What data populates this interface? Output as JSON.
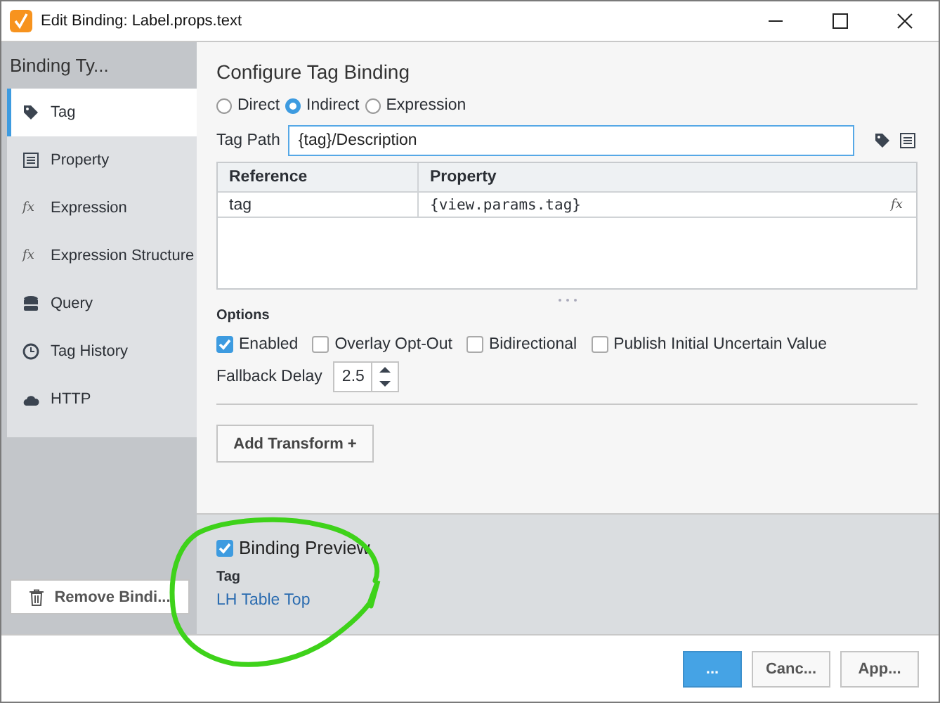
{
  "window": {
    "title": "Edit Binding: Label.props.text"
  },
  "sidebar": {
    "title": "Binding Ty...",
    "items": [
      {
        "label": "Tag",
        "selected": true
      },
      {
        "label": "Property",
        "selected": false
      },
      {
        "label": "Expression",
        "selected": false,
        "glyph": "fx"
      },
      {
        "label": "Expression Structure",
        "selected": false,
        "glyph": "fx"
      },
      {
        "label": "Query",
        "selected": false
      },
      {
        "label": "Tag History",
        "selected": false
      },
      {
        "label": "HTTP",
        "selected": false
      }
    ],
    "remove_button": "Remove Bindi..."
  },
  "config": {
    "title": "Configure Tag Binding",
    "modes": [
      {
        "label": "Direct",
        "selected": false
      },
      {
        "label": "Indirect",
        "selected": true
      },
      {
        "label": "Expression",
        "selected": false
      }
    ],
    "tag_path": {
      "label": "Tag Path",
      "value": "{tag}/Description"
    },
    "table": {
      "columns": [
        "Reference",
        "Property"
      ],
      "rows": [
        {
          "cells": [
            "tag",
            "{view.params.tag}"
          ],
          "action": "fx"
        }
      ]
    },
    "options": {
      "title": "Options",
      "checkboxes": [
        {
          "label": "Enabled",
          "checked": true
        },
        {
          "label": "Overlay Opt-Out",
          "checked": false
        },
        {
          "label": "Bidirectional",
          "checked": false
        },
        {
          "label": "Publish Initial Uncertain Value",
          "checked": false
        }
      ]
    },
    "fallback_delay": {
      "label": "Fallback Delay",
      "value": "2.5"
    },
    "add_transform": "Add Transform +"
  },
  "preview": {
    "label": "Binding Preview",
    "checked": true,
    "type_label": "Tag",
    "value": "LH Table Top"
  },
  "buttons": [
    {
      "label": "...",
      "kind": "primary"
    },
    {
      "label": "Canc...",
      "kind": "secondary"
    },
    {
      "label": "App...",
      "kind": "secondary"
    }
  ]
}
